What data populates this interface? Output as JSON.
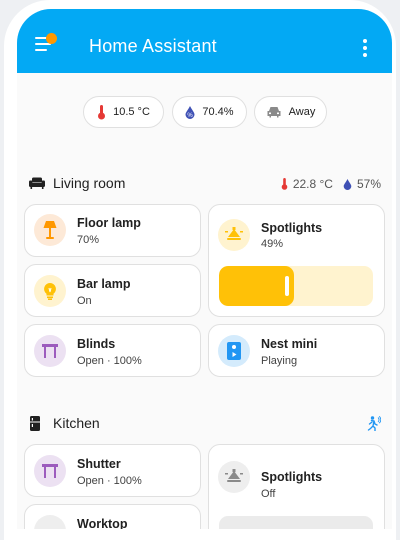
{
  "topbar": {
    "title": "Home Assistant"
  },
  "chips": {
    "temperature": "10.5 °C",
    "humidity": "70.4%",
    "presence": "Away"
  },
  "living_room": {
    "name": "Living room",
    "temperature": "22.8 °C",
    "humidity": "57%",
    "tiles": {
      "floor_lamp": {
        "name": "Floor lamp",
        "state": "70%"
      },
      "spotlights": {
        "name": "Spotlights",
        "state": "49%",
        "brightness": 0.49
      },
      "bar_lamp": {
        "name": "Bar lamp",
        "state": "On"
      },
      "blinds": {
        "name": "Blinds",
        "state": "Open · 100%"
      },
      "nest_mini": {
        "name": "Nest mini",
        "state": "Playing"
      }
    }
  },
  "kitchen": {
    "name": "Kitchen",
    "tiles": {
      "shutter": {
        "name": "Shutter",
        "state": "Open · 100%"
      },
      "spotlights": {
        "name": "Spotlights",
        "state": "Off",
        "brightness": 0
      },
      "partial": {
        "name": "Worktop"
      }
    }
  },
  "colors": {
    "primary": "#03a9f4",
    "amber": "#ffc107",
    "light_amber": "#fff3cf",
    "orange_lamp": "#ff9800",
    "purple_cover": "#9c5bbd",
    "blue_media": "#2196f3",
    "temp_red": "#e53935",
    "humidity_blue": "#3f51b5"
  }
}
